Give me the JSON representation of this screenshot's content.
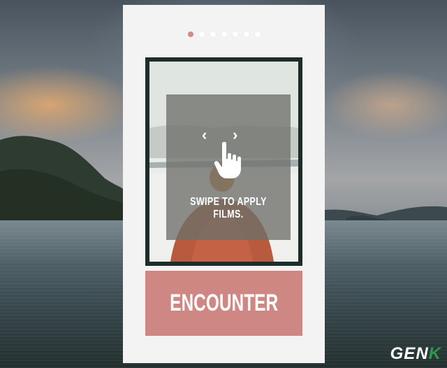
{
  "pager": {
    "count": 7,
    "active_index": 0
  },
  "overlay": {
    "hint": "SWIPE TO APPLY  FILMS."
  },
  "film": {
    "name": "ENCOUNTER"
  },
  "watermark": {
    "text": "GEN",
    "accent": "K"
  },
  "icons": {
    "left": "chevron-left-icon",
    "right": "chevron-right-icon",
    "hand": "swipe-hand-icon"
  },
  "colors": {
    "accent": "#cf8784",
    "frame": "#1e2d29",
    "card": "#f3f3f3",
    "active_dot": "#cf8a83"
  }
}
